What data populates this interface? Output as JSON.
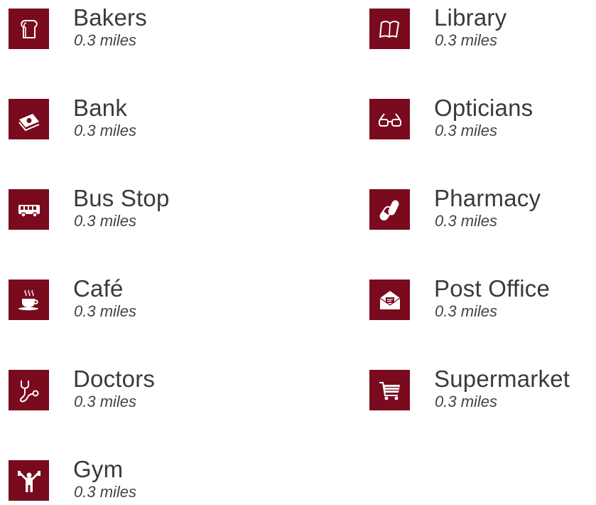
{
  "colors": {
    "icon_background": "#7a0a1e",
    "icon_foreground": "#ffffff",
    "name_text": "#3a3a3a",
    "distance_text": "#444444"
  },
  "amenities": {
    "left": [
      {
        "name": "Bakers",
        "distance": "0.3 miles",
        "icon": "bread-icon"
      },
      {
        "name": "Bank",
        "distance": "0.3 miles",
        "icon": "money-icon"
      },
      {
        "name": "Bus Stop",
        "distance": "0.3 miles",
        "icon": "bus-icon"
      },
      {
        "name": "Café",
        "distance": "0.3 miles",
        "icon": "coffee-cup-icon"
      },
      {
        "name": "Doctors",
        "distance": "0.3 miles",
        "icon": "stethoscope-icon"
      },
      {
        "name": "Gym",
        "distance": "0.3 miles",
        "icon": "weightlifter-icon"
      }
    ],
    "right": [
      {
        "name": "Library",
        "distance": "0.3 miles",
        "icon": "book-icon"
      },
      {
        "name": "Opticians",
        "distance": "0.3 miles",
        "icon": "glasses-icon"
      },
      {
        "name": "Pharmacy",
        "distance": "0.3 miles",
        "icon": "pills-icon"
      },
      {
        "name": "Post Office",
        "distance": "0.3 miles",
        "icon": "envelope-icon"
      },
      {
        "name": "Supermarket",
        "distance": "0.3 miles",
        "icon": "shopping-cart-icon"
      }
    ]
  }
}
